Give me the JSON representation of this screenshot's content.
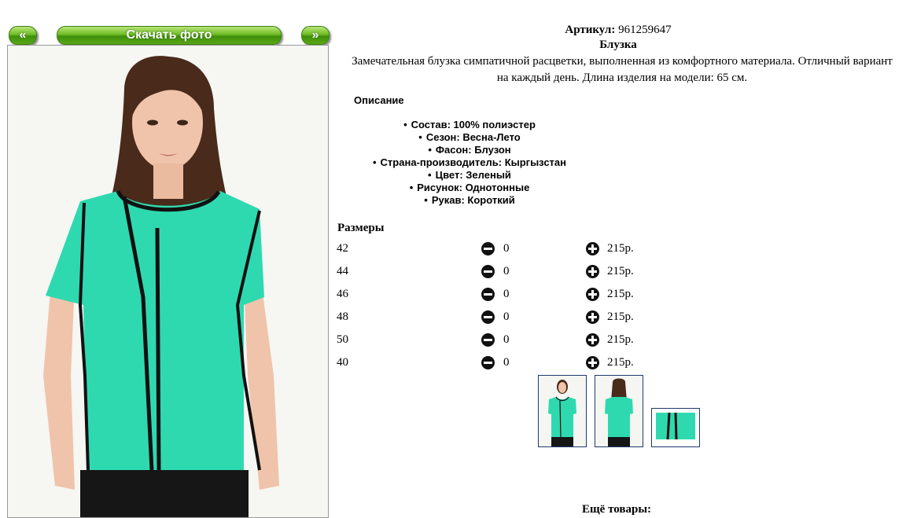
{
  "nav": {
    "prev_label": "«",
    "download_label": "Скачать фото",
    "next_label": "»"
  },
  "product": {
    "sku_label": "Артикул:",
    "sku_value": "961259647",
    "name": "Блузка",
    "description": "Замечательная блузка симпатичной расцветки, выполненная из комфортного материала. Отличный вариант на каждый день. Длина изделия на модели: 65 см.",
    "description_heading": "Описание",
    "properties": [
      "Состав: 100% полиэстер",
      "Сезон: Весна-Лето",
      "Фасон: Блузон",
      "Страна-производитель: Кыргызстан",
      "Цвет: Зеленый",
      "Рисунок: Однотонные",
      "Рукав: Короткий"
    ]
  },
  "sizes": {
    "heading": "Размеры",
    "rows": [
      {
        "size": "42",
        "qty": "0",
        "price": "215р."
      },
      {
        "size": "44",
        "qty": "0",
        "price": "215р."
      },
      {
        "size": "46",
        "qty": "0",
        "price": "215р."
      },
      {
        "size": "48",
        "qty": "0",
        "price": "215р."
      },
      {
        "size": "50",
        "qty": "0",
        "price": "215р."
      },
      {
        "size": "40",
        "qty": "0",
        "price": "215р."
      }
    ]
  },
  "footer": {
    "more_goods": "Ещё товары:"
  },
  "colors": {
    "blouse": "#2fd9b0",
    "trim": "#111111",
    "button_green": "#5aa815",
    "thumb_border": "#1e3a6e"
  },
  "icons": {
    "minus": "minus-circle-icon",
    "plus": "plus-circle-icon"
  }
}
